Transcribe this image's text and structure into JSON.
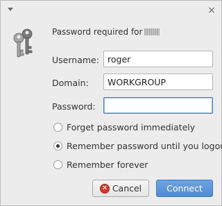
{
  "titlebar": {
    "menu_icon": "menu-arrow-icon",
    "close_glyph": "×"
  },
  "header": {
    "text": "Password required for",
    "icon": "keys-icon"
  },
  "form": {
    "username_label": "Username:",
    "username_value": "roger",
    "domain_label": "Domain:",
    "domain_value": "WORKGROUP",
    "password_label": "Password:",
    "password_value": ""
  },
  "options": [
    {
      "label": "Forget password immediately",
      "selected": false
    },
    {
      "label": "Remember password until you logout",
      "selected": true
    },
    {
      "label": "Remember forever",
      "selected": false
    }
  ],
  "buttons": {
    "cancel_label": "Cancel",
    "connect_label": "Connect"
  },
  "colors": {
    "accent": "#4f8bd3",
    "focus_border": "#3e86d6",
    "cancel_icon": "#d33b2c"
  }
}
